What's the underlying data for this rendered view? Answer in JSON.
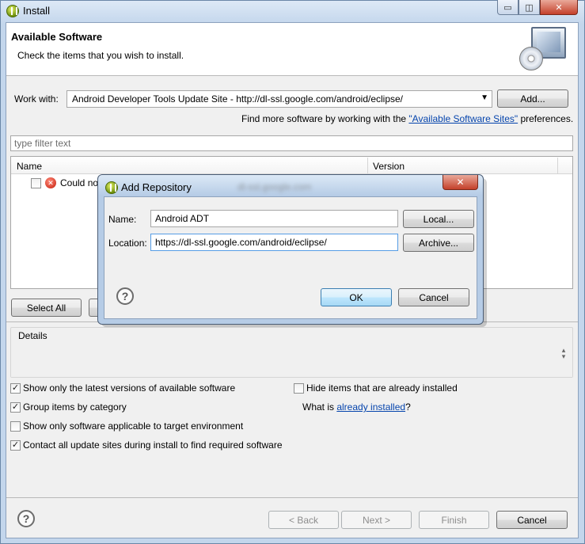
{
  "window": {
    "title": "Install",
    "controls": {
      "minimize": "▭",
      "maximize": "◫",
      "close": "✕"
    }
  },
  "banner": {
    "title": "Available Software",
    "subtitle": "Check the items that you wish to install."
  },
  "work_with": {
    "label": "Work with:",
    "value": "Android Developer Tools Update Site - http://dl-ssl.google.com/android/eclipse/",
    "add_button": "Add...",
    "find_more_prefix": "Find more software by working with the ",
    "find_more_link": "\"Available Software Sites\"",
    "find_more_suffix": " preferences."
  },
  "filter": {
    "placeholder": "type filter text"
  },
  "table": {
    "columns": [
      "Name",
      "Version"
    ],
    "rows": [
      {
        "name": "Could no",
        "checked": false,
        "status_icon": "error-icon"
      }
    ]
  },
  "buttons": {
    "select_all": "Select All"
  },
  "details": {
    "label": "Details"
  },
  "options": {
    "show_latest": {
      "label": "Show only the latest versions of available software",
      "checked": true
    },
    "group_by_category": {
      "label": "Group items by category",
      "checked": true
    },
    "show_applicable": {
      "label": "Show only software applicable to target environment",
      "checked": false
    },
    "contact_all": {
      "label": "Contact all update sites during install to find required software",
      "checked": true
    },
    "hide_installed": {
      "label": "Hide items that are already installed",
      "checked": false
    },
    "what_is_prefix": "What is ",
    "what_is_link": "already installed",
    "what_is_suffix": "?"
  },
  "footer": {
    "help": "?",
    "back": "< Back",
    "next": "Next >",
    "finish": "Finish",
    "cancel": "Cancel"
  },
  "dialog": {
    "title": "Add Repository",
    "close": "✕",
    "name_label": "Name:",
    "name_value": "Android ADT",
    "local_button": "Local...",
    "location_label": "Location:",
    "location_value": "https://dl-ssl.google.com/android/eclipse/",
    "archive_button": "Archive...",
    "help": "?",
    "ok": "OK",
    "cancel": "Cancel"
  },
  "colors": {
    "link": "#0645ad",
    "window_frame": "#c3d6ec",
    "error": "#c41d0a"
  }
}
